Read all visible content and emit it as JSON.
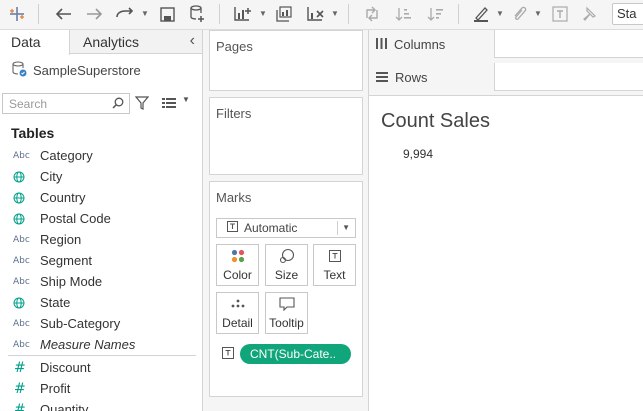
{
  "toolbar": {
    "search_value": "Sta",
    "icons": [
      "tableau-logo-icon",
      "back-icon",
      "forward-icon",
      "redo-icon",
      "save-icon",
      "add-datasource-icon",
      "new-worksheet-icon",
      "duplicate-sheet-icon",
      "clear-sheet-icon",
      "swap-icon",
      "sort-ascending-icon",
      "sort-descending-icon",
      "highlight-icon",
      "attach-icon",
      "text-label-icon",
      "pin-icon"
    ]
  },
  "data_pane": {
    "tabs": [
      "Data",
      "Analytics"
    ],
    "datasource": "SampleSuperstore",
    "search_placeholder": "Search",
    "tables_heading": "Tables",
    "dimensions": [
      {
        "type": "Abc",
        "name": "Category"
      },
      {
        "type": "geo",
        "name": "City"
      },
      {
        "type": "geo",
        "name": "Country"
      },
      {
        "type": "geo",
        "name": "Postal Code"
      },
      {
        "type": "Abc",
        "name": "Region"
      },
      {
        "type": "Abc",
        "name": "Segment"
      },
      {
        "type": "Abc",
        "name": "Ship Mode"
      },
      {
        "type": "geo",
        "name": "State"
      },
      {
        "type": "Abc",
        "name": "Sub-Category"
      },
      {
        "type": "Abc",
        "name": "Measure Names"
      }
    ],
    "measures": [
      {
        "type": "#",
        "name": "Discount"
      },
      {
        "type": "#",
        "name": "Profit"
      },
      {
        "type": "#",
        "name": "Quantity"
      }
    ],
    "type_glyphs": {
      "Abc": "Abc",
      "#": "#"
    }
  },
  "cards": {
    "pages": "Pages",
    "filters": "Filters",
    "marks": "Marks",
    "mark_type": "Automatic",
    "mark_buttons": [
      "Color",
      "Size",
      "Text",
      "Detail",
      "Tooltip"
    ],
    "pill": "CNT(Sub-Cate.."
  },
  "shelves": {
    "columns": "Columns",
    "rows": "Rows"
  },
  "view": {
    "title": "Count Sales",
    "value": "9,994"
  },
  "colors": {
    "accent": "#10a57a",
    "measure": "#00a08a",
    "dimension": "#5b6f8a"
  }
}
